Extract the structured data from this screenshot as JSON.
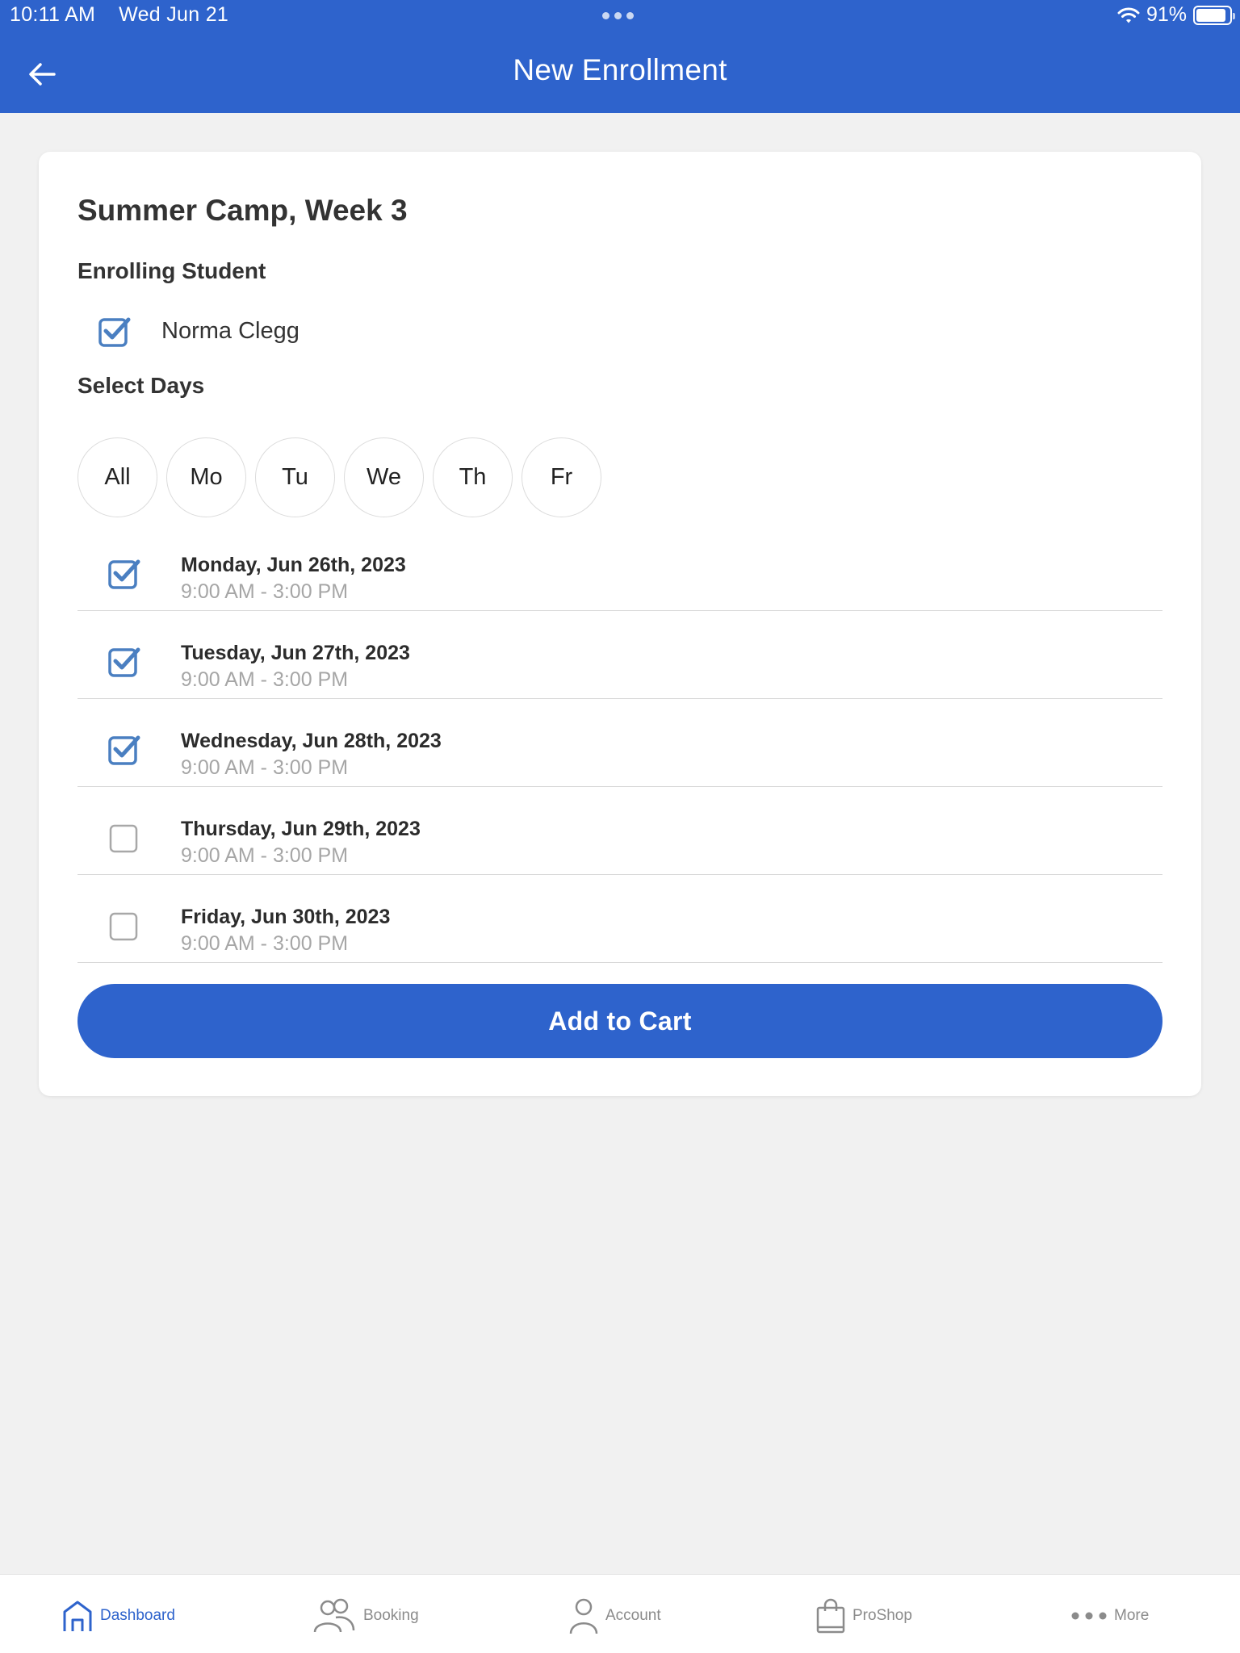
{
  "status_bar": {
    "time": "10:11 AM",
    "date": "Wed Jun 21",
    "battery": "91%",
    "battery_level": 0.91
  },
  "header": {
    "title": "New Enrollment",
    "back_icon": "arrow-left-icon"
  },
  "card": {
    "course_title": "Summer Camp, Week 3",
    "enrolling_label": "Enrolling Student",
    "student": {
      "name": "Norma Clegg",
      "checked": true
    },
    "select_days_label": "Select Days",
    "day_filters": [
      "All",
      "Mo",
      "Tu",
      "We",
      "Th",
      "Fr"
    ],
    "dates": [
      {
        "title": "Monday, Jun 26th, 2023",
        "time": "9:00 AM - 3:00 PM",
        "checked": true
      },
      {
        "title": "Tuesday, Jun 27th, 2023",
        "time": "9:00 AM - 3:00 PM",
        "checked": true
      },
      {
        "title": "Wednesday, Jun 28th, 2023",
        "time": "9:00 AM - 3:00 PM",
        "checked": true
      },
      {
        "title": "Thursday, Jun 29th, 2023",
        "time": "9:00 AM - 3:00 PM",
        "checked": false
      },
      {
        "title": "Friday, Jun 30th, 2023",
        "time": "9:00 AM - 3:00 PM",
        "checked": false
      }
    ],
    "add_to_cart": "Add to Cart"
  },
  "tabbar": {
    "items": [
      {
        "label": "Dashboard",
        "icon": "home-icon",
        "active": true
      },
      {
        "label": "Booking",
        "icon": "people-icon",
        "active": false
      },
      {
        "label": "Account",
        "icon": "person-icon",
        "active": false
      },
      {
        "label": "ProShop",
        "icon": "shopping-bag-icon",
        "active": false
      },
      {
        "label": "More",
        "icon": "more-dots-icon",
        "active": false
      }
    ]
  },
  "colors": {
    "brand": "#2e63cc",
    "checkbox": "#4a7fc1",
    "background": "#f1f1f1"
  }
}
